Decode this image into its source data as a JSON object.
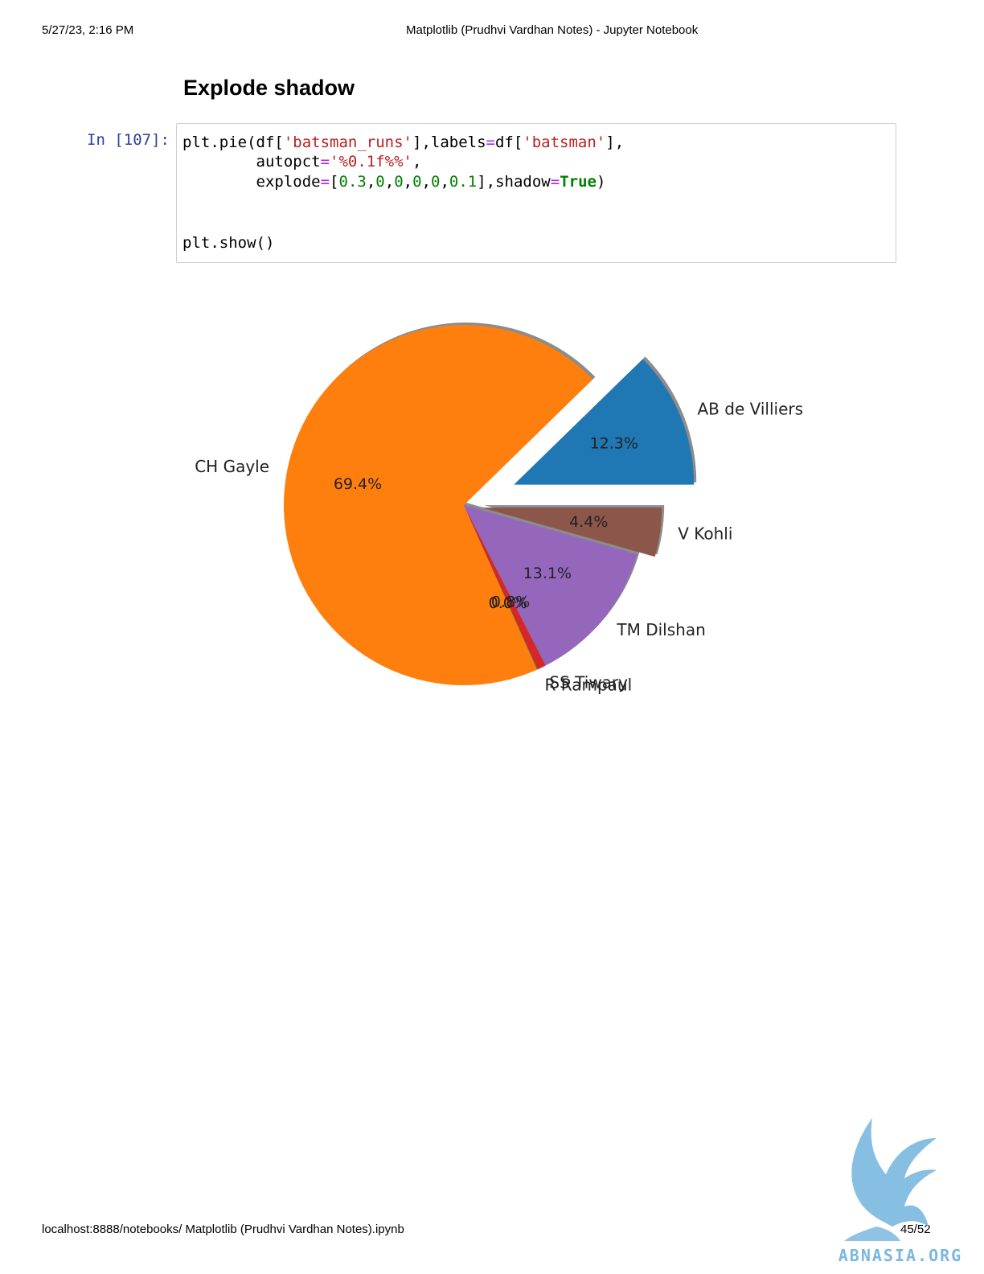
{
  "print_header": {
    "datetime": "5/27/23, 2:16 PM",
    "title": "Matplotlib (Prudhvi Vardhan Notes) - Jupyter Notebook"
  },
  "section": {
    "heading": "Explode shadow"
  },
  "cell": {
    "prompt": "In [107]:",
    "lines": [
      [
        {
          "t": "plt.pie(df[",
          "c": ""
        },
        {
          "t": "'batsman_runs'",
          "c": "str"
        },
        {
          "t": "],labels",
          "c": ""
        },
        {
          "t": "=",
          "c": "op"
        },
        {
          "t": "df[",
          "c": ""
        },
        {
          "t": "'batsman'",
          "c": "str"
        },
        {
          "t": "],",
          "c": ""
        }
      ],
      [
        {
          "t": "        autopct",
          "c": ""
        },
        {
          "t": "=",
          "c": "op"
        },
        {
          "t": "'%0.1f%%'",
          "c": "str"
        },
        {
          "t": ",",
          "c": ""
        }
      ],
      [
        {
          "t": "        explode",
          "c": ""
        },
        {
          "t": "=",
          "c": "op"
        },
        {
          "t": "[",
          "c": ""
        },
        {
          "t": "0.3",
          "c": "num"
        },
        {
          "t": ",",
          "c": ""
        },
        {
          "t": "0",
          "c": "num"
        },
        {
          "t": ",",
          "c": ""
        },
        {
          "t": "0",
          "c": "num"
        },
        {
          "t": ",",
          "c": ""
        },
        {
          "t": "0",
          "c": "num"
        },
        {
          "t": ",",
          "c": ""
        },
        {
          "t": "0",
          "c": "num"
        },
        {
          "t": ",",
          "c": ""
        },
        {
          "t": "0.1",
          "c": "num"
        },
        {
          "t": "],shadow",
          "c": ""
        },
        {
          "t": "=",
          "c": "op"
        },
        {
          "t": "True",
          "c": "kw"
        },
        {
          "t": ")",
          "c": ""
        }
      ],
      [],
      [],
      [
        {
          "t": "plt.show()",
          "c": ""
        }
      ]
    ]
  },
  "chart_data": {
    "type": "pie",
    "shadow": true,
    "start_angle_deg": 0,
    "direction": "counterclockwise",
    "slices": [
      {
        "label": "AB de Villiers",
        "pct_label": "12.3%",
        "value": 12.3,
        "explode": 0.3,
        "color": "#1f77b4"
      },
      {
        "label": "CH Gayle",
        "pct_label": "69.4%",
        "value": 69.4,
        "explode": 0,
        "color": "#ff7f0e"
      },
      {
        "label": "R Rampaul",
        "pct_label": "0.0%",
        "value": 0.04,
        "explode": 0,
        "color": "#2ca02c"
      },
      {
        "label": "SS Tiwary",
        "pct_label": "0.8%",
        "value": 0.8,
        "explode": 0,
        "color": "#d62728"
      },
      {
        "label": "TM Dilshan",
        "pct_label": "13.1%",
        "value": 13.1,
        "explode": 0,
        "color": "#9467bd"
      },
      {
        "label": "V Kohli",
        "pct_label": "4.4%",
        "value": 4.4,
        "explode": 0.1,
        "color": "#8c564b"
      }
    ]
  },
  "print_footer": {
    "url": "localhost:8888/notebooks/ Matplotlib (Prudhvi Vardhan Notes).ipynb",
    "page": "45/52"
  },
  "watermark": {
    "text": "ABNASIA.ORG",
    "color": "#7ab8e0"
  }
}
